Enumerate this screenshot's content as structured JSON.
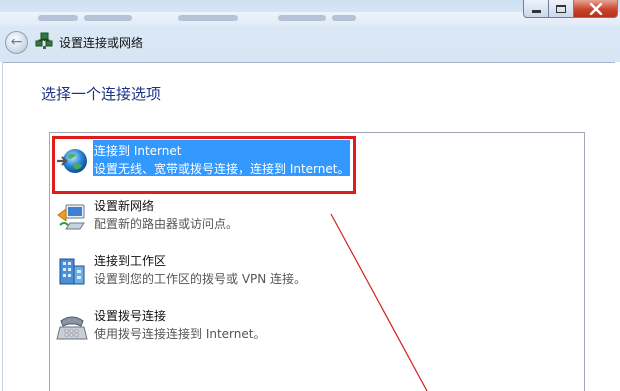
{
  "window": {
    "title": "设置连接或网络"
  },
  "content": {
    "heading": "选择一个连接选项"
  },
  "options": [
    {
      "title": "连接到 Internet",
      "description": "设置无线、宽带或拨号连接，连接到 Internet。",
      "icon": "globe-internet-icon",
      "selected": true
    },
    {
      "title": "设置新网络",
      "description": "配置新的路由器或访问点。",
      "icon": "router-network-icon",
      "selected": false
    },
    {
      "title": "连接到工作区",
      "description": "设置到您的工作区的拨号或 VPN 连接。",
      "icon": "workplace-building-icon",
      "selected": false
    },
    {
      "title": "设置拨号连接",
      "description": "使用拨号连接连接到 Internet。",
      "icon": "dialup-phone-icon",
      "selected": false
    }
  ],
  "colors": {
    "selection": "#3399ff",
    "heading": "#1e3287",
    "annotation": "#e01b1b"
  }
}
